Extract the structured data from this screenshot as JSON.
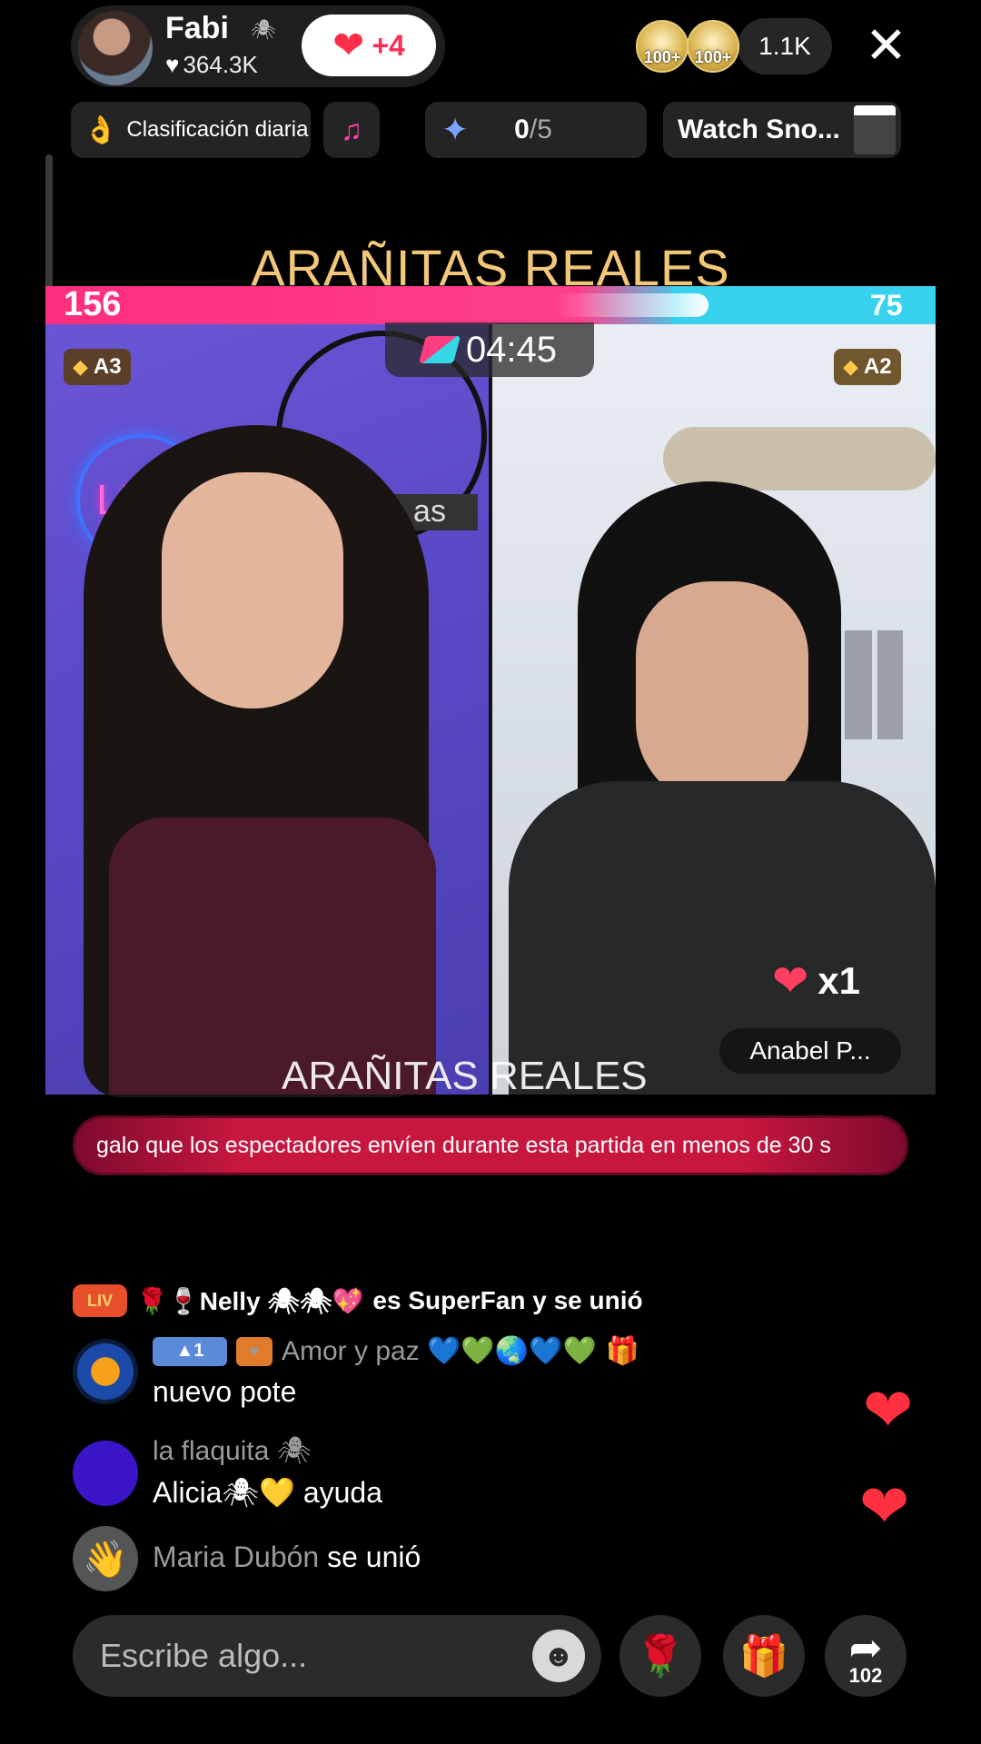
{
  "header": {
    "host_name": "Fabi",
    "host_likes": "364.3K",
    "follow_plus": "+4",
    "badge_1": "100+",
    "badge_2": "100+",
    "viewer_count": "1.1K"
  },
  "topbar": {
    "ranking_label": "Clasificación diaria",
    "goal_current": "0",
    "goal_total": "/5",
    "watch_label": "Watch Sno..."
  },
  "battle": {
    "title": "ARAÑITAS REALES",
    "score_left": "156",
    "score_right": "75",
    "timer": "04:45",
    "rank_left": "A3",
    "rank_right": "A2",
    "multiplier": "x1",
    "opponent_name": "Anabel P...",
    "watermark": "ARAÑITAS REALES",
    "live_sign": "LIVE",
    "logo_text": "as"
  },
  "ticker": {
    "text": "galo que los espectadores envíen durante esta partida en menos de 30 s"
  },
  "chat": {
    "join_badge": "LIV",
    "join_user": "🌹🍷Nelly 🕷🕷💖",
    "join_text": "es SuperFan y se unió",
    "messages": [
      {
        "level": "1",
        "name": "Amor y paz 💙💚🌏💙💚",
        "text": "nuevo pote"
      },
      {
        "name": "la flaquita 🕷",
        "text": "Alicia🕷💛 ayuda"
      }
    ],
    "joined_user": "Maria Dubón",
    "joined_text": "se unió"
  },
  "bottom": {
    "comment_placeholder": "Escribe algo...",
    "share_count": "102"
  },
  "colors": {
    "accent_pink": "#ff2e7e",
    "accent_cyan": "#38d1ee",
    "heart_red": "#ff3040",
    "title_gold": "#f2c77a"
  }
}
